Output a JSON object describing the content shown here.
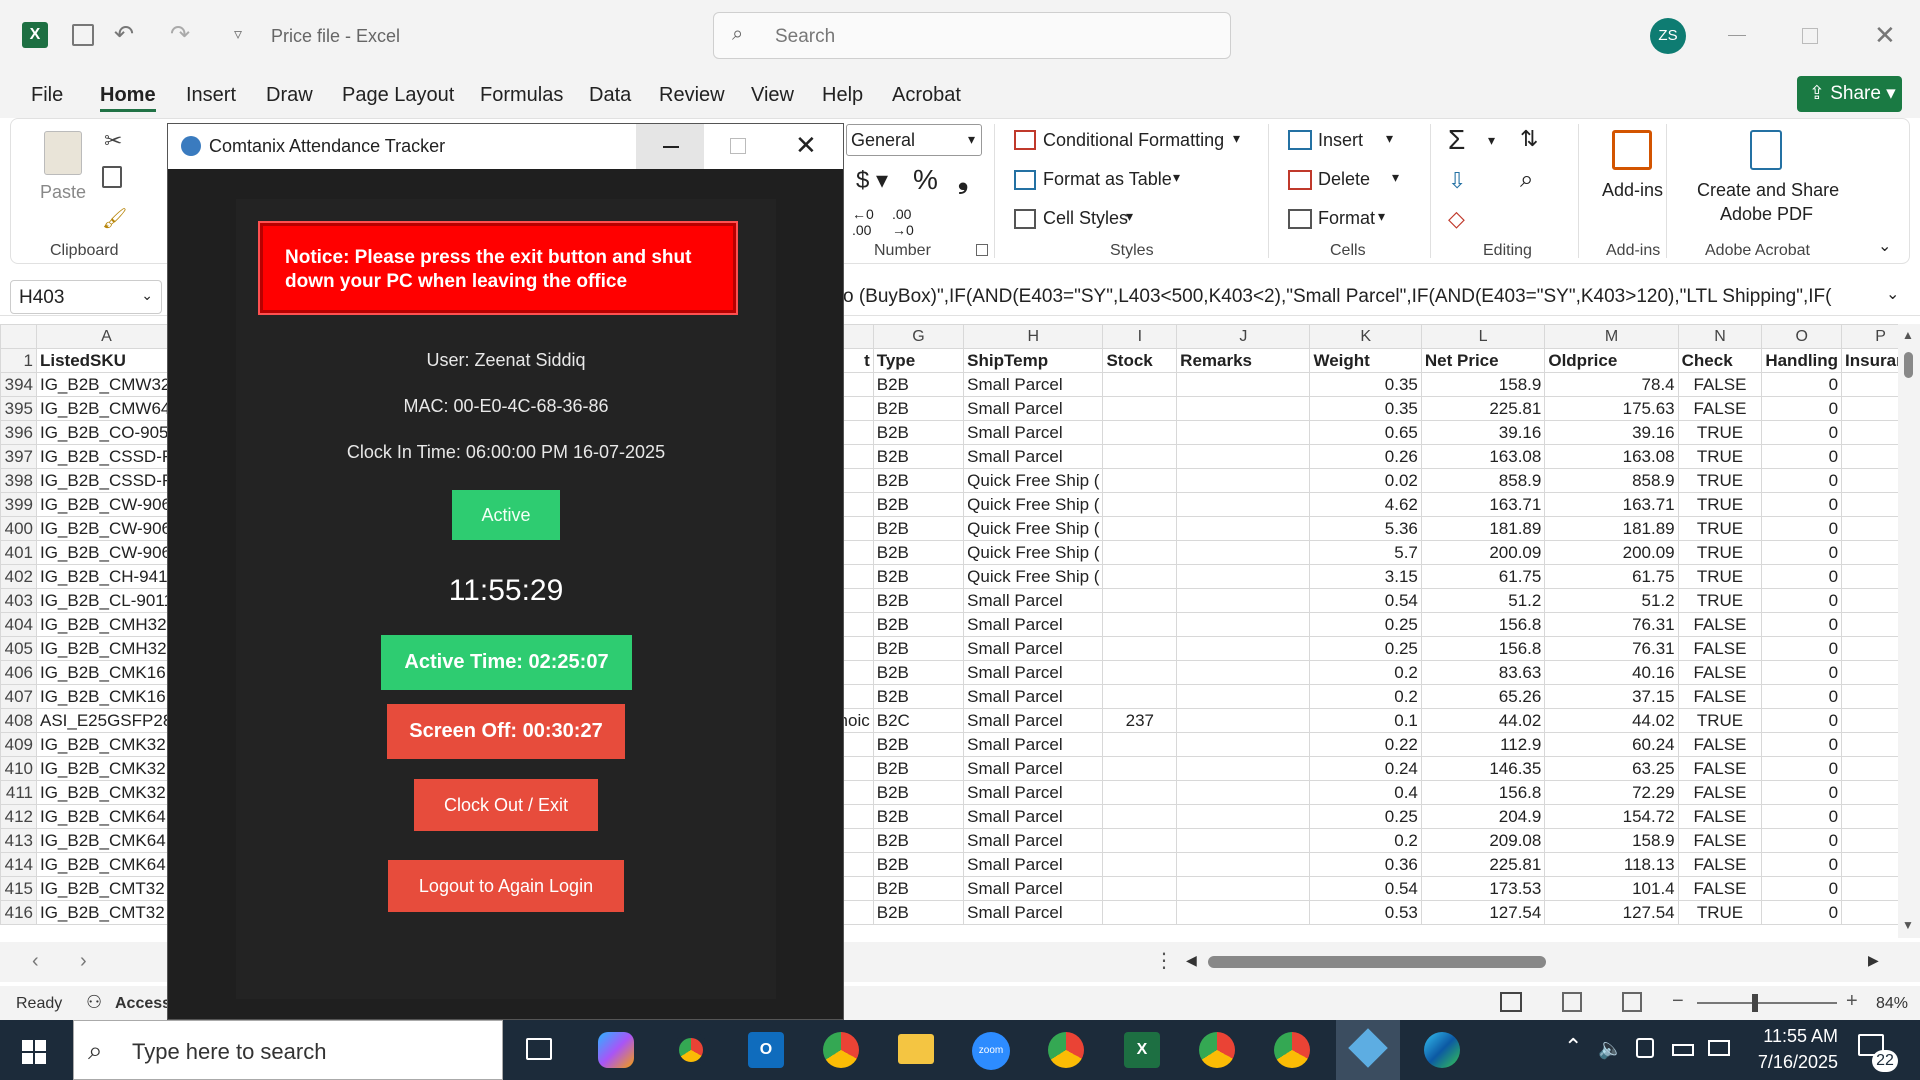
{
  "window": {
    "title": "Price file  -  Excel",
    "search_placeholder": "Search",
    "user_initials": "ZS",
    "share_label": "Share"
  },
  "menu": [
    "File",
    "Home",
    "Insert",
    "Draw",
    "Page Layout",
    "Formulas",
    "Data",
    "Review",
    "View",
    "Help",
    "Acrobat"
  ],
  "ribbon": {
    "paste": "Paste",
    "clipboard": "Clipboard",
    "number_format": "General",
    "number": "Number",
    "conditional_formatting": "Conditional Formatting",
    "format_as_table": "Format as Table",
    "cell_styles": "Cell Styles",
    "styles": "Styles",
    "insert": "Insert",
    "delete": "Delete",
    "format": "Format",
    "cells": "Cells",
    "editing": "Editing",
    "add_ins": "Add-ins",
    "add_ins_group": "Add-ins",
    "create_share_pdf": "Create and Share",
    "adobe_pdf": "Adobe PDF",
    "adobe_acrobat": "Adobe Acrobat"
  },
  "formula_bar": {
    "name_box": "H403",
    "formula": "o (BuyBox)\",IF(AND(E403=\"SY\",L403<500,K403<2),\"Small Parcel\",IF(AND(E403=\"SY\",K403>120),\"LTL Shipping\",IF("
  },
  "columns_left": [
    "A"
  ],
  "columns_right": [
    "G",
    "H",
    "I",
    "J",
    "K",
    "L",
    "M",
    "N",
    "O",
    "P"
  ],
  "header_row": {
    "num": "1",
    "A": "ListedSKU",
    "F": "t",
    "G": "Type",
    "H": "ShipTemp",
    "I": "Stock",
    "J": "Remarks",
    "K": "Weight",
    "L": "Net Price",
    "M": "Oldprice",
    "N": "Check",
    "O": "Handling",
    "P": "Insuran"
  },
  "rows": [
    {
      "n": "394",
      "A": "IG_B2B_CMW32",
      "F": "",
      "G": "B2B",
      "H": "Small Parcel",
      "I": "",
      "K": "0.35",
      "L": "158.9",
      "M": "78.4",
      "N": "FALSE",
      "O": "0"
    },
    {
      "n": "395",
      "A": "IG_B2B_CMW64",
      "F": "",
      "G": "B2B",
      "H": "Small Parcel",
      "I": "",
      "K": "0.35",
      "L": "225.81",
      "M": "175.63",
      "N": "FALSE",
      "O": "0"
    },
    {
      "n": "396",
      "A": "IG_B2B_CO-905",
      "F": "",
      "G": "B2B",
      "H": "Small Parcel",
      "I": "",
      "K": "0.65",
      "L": "39.16",
      "M": "39.16",
      "N": "TRUE",
      "O": "0"
    },
    {
      "n": "397",
      "A": "IG_B2B_CSSD-F",
      "F": "",
      "G": "B2B",
      "H": "Small Parcel",
      "I": "",
      "K": "0.26",
      "L": "163.08",
      "M": "163.08",
      "N": "TRUE",
      "O": "0"
    },
    {
      "n": "398",
      "A": "IG_B2B_CSSD-F",
      "F": "",
      "G": "B2B",
      "H": "Quick Free Ship (",
      "I": "",
      "K": "0.02",
      "L": "858.9",
      "M": "858.9",
      "N": "TRUE",
      "O": "0"
    },
    {
      "n": "399",
      "A": "IG_B2B_CW-906",
      "F": "",
      "G": "B2B",
      "H": "Quick Free Ship (",
      "I": "",
      "K": "4.62",
      "L": "163.71",
      "M": "163.71",
      "N": "TRUE",
      "O": "0"
    },
    {
      "n": "400",
      "A": "IG_B2B_CW-906",
      "F": "",
      "G": "B2B",
      "H": "Quick Free Ship (",
      "I": "",
      "K": "5.36",
      "L": "181.89",
      "M": "181.89",
      "N": "TRUE",
      "O": "0"
    },
    {
      "n": "401",
      "A": "IG_B2B_CW-906",
      "F": "",
      "G": "B2B",
      "H": "Quick Free Ship (",
      "I": "",
      "K": "5.7",
      "L": "200.09",
      "M": "200.09",
      "N": "TRUE",
      "O": "0"
    },
    {
      "n": "402",
      "A": "IG_B2B_CH-941",
      "F": "",
      "G": "B2B",
      "H": "Quick Free Ship (",
      "I": "",
      "K": "3.15",
      "L": "61.75",
      "M": "61.75",
      "N": "TRUE",
      "O": "0"
    },
    {
      "n": "403",
      "A": "IG_B2B_CL-9011",
      "F": "",
      "G": "B2B",
      "H": "Small Parcel",
      "I": "",
      "K": "0.54",
      "L": "51.2",
      "M": "51.2",
      "N": "TRUE",
      "O": "0"
    },
    {
      "n": "404",
      "A": "IG_B2B_CMH32",
      "F": "",
      "G": "B2B",
      "H": "Small Parcel",
      "I": "",
      "K": "0.25",
      "L": "156.8",
      "M": "76.31",
      "N": "FALSE",
      "O": "0"
    },
    {
      "n": "405",
      "A": "IG_B2B_CMH32",
      "F": "",
      "G": "B2B",
      "H": "Small Parcel",
      "I": "",
      "K": "0.25",
      "L": "156.8",
      "M": "76.31",
      "N": "FALSE",
      "O": "0"
    },
    {
      "n": "406",
      "A": "IG_B2B_CMK16",
      "F": "",
      "G": "B2B",
      "H": "Small Parcel",
      "I": "",
      "K": "0.2",
      "L": "83.63",
      "M": "40.16",
      "N": "FALSE",
      "O": "0"
    },
    {
      "n": "407",
      "A": "IG_B2B_CMK16",
      "F": "",
      "G": "B2B",
      "H": "Small Parcel",
      "I": "",
      "K": "0.2",
      "L": "65.26",
      "M": "37.15",
      "N": "FALSE",
      "O": "0"
    },
    {
      "n": "408",
      "A": "ASI_E25GSFP28",
      "F": "hoic",
      "G": "B2C",
      "H": "Small Parcel",
      "I": "237",
      "K": "0.1",
      "L": "44.02",
      "M": "44.02",
      "N": "TRUE",
      "O": "0"
    },
    {
      "n": "409",
      "A": "IG_B2B_CMK32",
      "F": "",
      "G": "B2B",
      "H": "Small Parcel",
      "I": "",
      "K": "0.22",
      "L": "112.9",
      "M": "60.24",
      "N": "FALSE",
      "O": "0"
    },
    {
      "n": "410",
      "A": "IG_B2B_CMK32",
      "F": "",
      "G": "B2B",
      "H": "Small Parcel",
      "I": "",
      "K": "0.24",
      "L": "146.35",
      "M": "63.25",
      "N": "FALSE",
      "O": "0"
    },
    {
      "n": "411",
      "A": "IG_B2B_CMK32",
      "F": "",
      "G": "B2B",
      "H": "Small Parcel",
      "I": "",
      "K": "0.4",
      "L": "156.8",
      "M": "72.29",
      "N": "FALSE",
      "O": "0"
    },
    {
      "n": "412",
      "A": "IG_B2B_CMK64",
      "F": "",
      "G": "B2B",
      "H": "Small Parcel",
      "I": "",
      "K": "0.25",
      "L": "204.9",
      "M": "154.72",
      "N": "FALSE",
      "O": "0"
    },
    {
      "n": "413",
      "A": "IG_B2B_CMK64",
      "F": "",
      "G": "B2B",
      "H": "Small Parcel",
      "I": "",
      "K": "0.2",
      "L": "209.08",
      "M": "158.9",
      "N": "FALSE",
      "O": "0"
    },
    {
      "n": "414",
      "A": "IG_B2B_CMK64",
      "F": "",
      "G": "B2B",
      "H": "Small Parcel",
      "I": "",
      "K": "0.36",
      "L": "225.81",
      "M": "118.13",
      "N": "FALSE",
      "O": "0"
    },
    {
      "n": "415",
      "A": "IG_B2B_CMT32",
      "F": "",
      "G": "B2B",
      "H": "Small Parcel",
      "I": "",
      "K": "0.54",
      "L": "173.53",
      "M": "101.4",
      "N": "FALSE",
      "O": "0"
    },
    {
      "n": "416",
      "A": "IG_B2B_CMT32",
      "F": "",
      "G": "B2B",
      "H": "Small Parcel",
      "I": "",
      "K": "0.53",
      "L": "127.54",
      "M": "127.54",
      "N": "TRUE",
      "O": "0"
    }
  ],
  "dialog": {
    "title": "Comtanix Attendance Tracker",
    "notice": "Notice: Please press the exit button and shut down your PC when leaving the office",
    "user": "User: Zeenat Siddiq",
    "mac": "MAC: 00-E0-4C-68-36-86",
    "clock_in": "Clock In Time: 06:00:00 PM 16-07-2025",
    "status": "Active",
    "clock": "11:55:29",
    "active_time": "Active Time: 02:25:07",
    "screen_off": "Screen Off: 00:30:27",
    "clock_out": "Clock Out / Exit",
    "logout": "Logout to Again Login"
  },
  "status_bar": {
    "ready": "Ready",
    "accessibility": "Accessi",
    "zoom": "84%"
  },
  "taskbar": {
    "search_placeholder": "Type here to search",
    "time": "11:55 AM",
    "date": "7/16/2025",
    "notification_count": "22"
  },
  "colors": {
    "excel_green": "#217346",
    "notice_red": "#ff0000",
    "active_green": "#2ecc71",
    "button_red": "#e74c3c"
  }
}
